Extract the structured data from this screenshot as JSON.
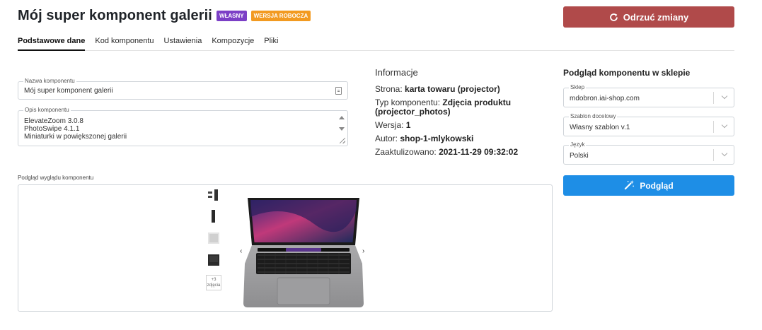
{
  "header": {
    "title": "Mój super komponent galerii",
    "badge_own": "Własny",
    "badge_draft": "Wersja robocza",
    "discard_label": "Odrzuć zmiany"
  },
  "tabs": [
    {
      "label": "Podstawowe dane",
      "active": true
    },
    {
      "label": "Kod komponentu"
    },
    {
      "label": "Ustawienia"
    },
    {
      "label": "Kompozycje"
    },
    {
      "label": "Pliki"
    }
  ],
  "form": {
    "name_label": "Nazwa komponentu",
    "name_value": "Mój super komponent galerii",
    "desc_label": "Opis komponentu",
    "desc_lines": [
      "ElevateZoom 3.0.8",
      "PhotoSwipe 4.1.1",
      "Miniaturki w powiększonej galerii"
    ]
  },
  "info": {
    "title": "Informacje",
    "page_label": "Strona:",
    "page_value": "karta towaru (projector)",
    "type_label": "Typ komponentu:",
    "type_value": "Zdjęcia produktu (projector_photos)",
    "version_label": "Wersja:",
    "version_value": "1",
    "author_label": "Autor:",
    "author_value": "shop-1-mlykowski",
    "updated_label": "Zaaktulizowano:",
    "updated_value": "2021-11-29 09:32:02"
  },
  "preview": {
    "title": "Podgląd komponentu w sklepie",
    "shop_label": "Sklep",
    "shop_value": "mdobron.iai-shop.com",
    "template_label": "Szablon docelowy",
    "template_value": "Własny szablon v.1",
    "lang_label": "Język",
    "lang_value": "Polski",
    "button_label": "Podgląd"
  },
  "look": {
    "label": "Podgląd wyglądu komponentu",
    "more_count": "+3",
    "more_label": "zdjęcia",
    "prev": "‹",
    "next": "›"
  },
  "colors": {
    "discard": "#b04a4a",
    "preview_button": "#1e8ee6",
    "badge_own": "#7b3fc6",
    "badge_draft": "#f29a21"
  }
}
